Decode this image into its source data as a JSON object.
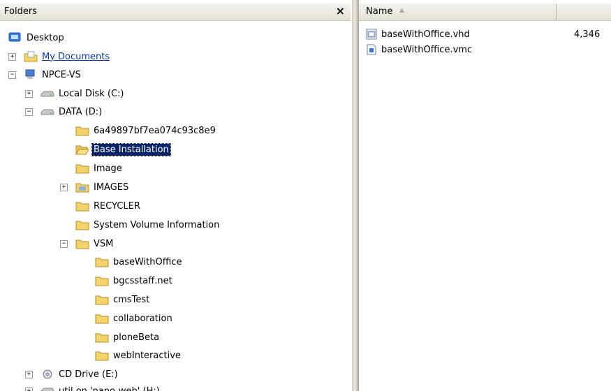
{
  "folders_pane": {
    "title": "Folders",
    "close_label": "×",
    "tree": [
      {
        "label": "Desktop",
        "icon": "desktop-icon",
        "expander": ""
      },
      {
        "label": "My Documents",
        "icon": "my-documents-icon",
        "expander": "+"
      },
      {
        "label": "NPCE-VS",
        "icon": "computer-icon",
        "expander": "−"
      },
      {
        "label": "Local Disk (C:)",
        "icon": "hard-drive-icon",
        "expander": "+"
      },
      {
        "label": "DATA (D:)",
        "icon": "hard-drive-icon",
        "expander": "−"
      },
      {
        "label": "6a49897bf7ea074c93c8e9",
        "icon": "folder-icon",
        "expander": ""
      },
      {
        "label": "Base Installation",
        "icon": "folder-open-icon",
        "expander": ""
      },
      {
        "label": "Image",
        "icon": "folder-icon",
        "expander": ""
      },
      {
        "label": "IMAGES",
        "icon": "folder-pictures-icon",
        "expander": "+"
      },
      {
        "label": "RECYCLER",
        "icon": "folder-icon",
        "expander": ""
      },
      {
        "label": "System Volume Information",
        "icon": "folder-icon",
        "expander": ""
      },
      {
        "label": "VSM",
        "icon": "folder-icon",
        "expander": "−"
      },
      {
        "label": "baseWithOffice",
        "icon": "folder-icon",
        "expander": ""
      },
      {
        "label": "bgcsstaff.net",
        "icon": "folder-icon",
        "expander": ""
      },
      {
        "label": "cmsTest",
        "icon": "folder-icon",
        "expander": ""
      },
      {
        "label": "collaboration",
        "icon": "folder-icon",
        "expander": ""
      },
      {
        "label": "ploneBeta",
        "icon": "folder-icon",
        "expander": ""
      },
      {
        "label": "webInteractive",
        "icon": "folder-icon",
        "expander": ""
      },
      {
        "label": "CD Drive (E:)",
        "icon": "cd-drive-icon",
        "expander": "+"
      },
      {
        "label": "util on 'nano-web' (H:)",
        "icon": "network-drive-icon",
        "expander": "+"
      }
    ],
    "selected": "Base Installation"
  },
  "file_list": {
    "columns": {
      "name": "Name",
      "sort_icon": "sort-ascending-icon"
    },
    "files": [
      {
        "name": "baseWithOffice.vhd",
        "size": "4,346",
        "icon": "vhd-file-icon"
      },
      {
        "name": "baseWithOffice.vmc",
        "size": "",
        "icon": "vmc-file-icon"
      }
    ]
  },
  "colors": {
    "selection": "#0a246a",
    "header": "#ece9d8",
    "folder": "#f5d36b"
  }
}
